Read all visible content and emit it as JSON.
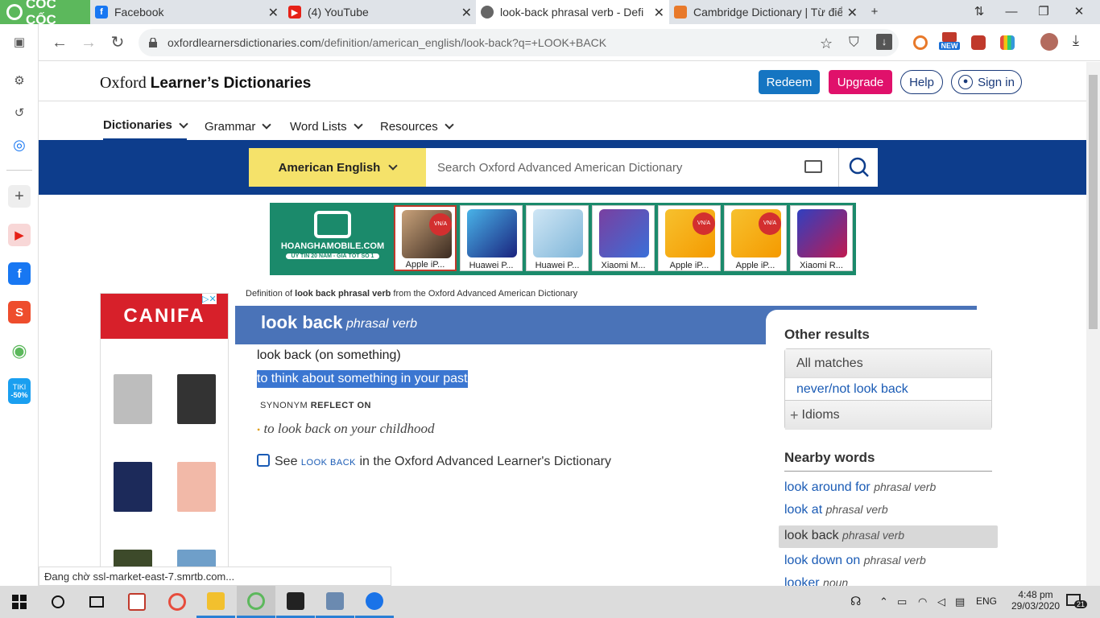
{
  "browser": {
    "brand": "CỐC CỐC",
    "tabs": [
      {
        "title": "Facebook",
        "icon": "facebook-icon",
        "color": "#1877f2"
      },
      {
        "title": "(4) YouTube",
        "icon": "youtube-icon",
        "color": "#e62117"
      },
      {
        "title": "look-back phrasal verb - Defi",
        "icon": "globe-icon",
        "color": "#444444"
      },
      {
        "title": "Cambridge Dictionary | Từ điể",
        "icon": "cambridge-icon",
        "color": "#e8792a"
      }
    ],
    "url_host": "oxfordlearnersdictionaries.com",
    "url_path": "/definition/american_english/look-back?q=+LOOK+BACK",
    "ext_new_badge": "NEW"
  },
  "sidebar": {
    "tiki_label": "TIKI",
    "tiki_discount": "-50%"
  },
  "site": {
    "logo_oxford": "Oxford",
    "logo_rest": "Learner’s Dictionaries",
    "redeem": "Redeem",
    "upgrade": "Upgrade",
    "help": "Help",
    "signin": "Sign in",
    "nav": [
      "Dictionaries",
      "Grammar",
      "Word Lists",
      "Resources"
    ],
    "dict_select": "American English",
    "search_placeholder": "Search Oxford Advanced American Dictionary",
    "accent": "#0d3d8c",
    "redeem_color": "#1575c2",
    "upgrade_color": "#e0116b"
  },
  "ad": {
    "brand": "HOANGHAMOBILE.COM",
    "tagline": "UY TÍN 20 NĂM - GIÁ TỐT SỐ 1",
    "badge": "VN/A",
    "phones": [
      "Apple iP...",
      "Huawei P...",
      "Huawei P...",
      "Xiaomi M...",
      "Apple iP...",
      "Apple iP...",
      "Xiaomi R..."
    ]
  },
  "side_ad": {
    "brand": "CANIFA"
  },
  "entry": {
    "breadcrumb_pre": "Definition of ",
    "breadcrumb_bold": "look back phrasal verb",
    "breadcrumb_post": " from the Oxford Advanced American Dictionary",
    "headword": "look back",
    "pos": "phrasal verb",
    "sense_head": "look back (on something)",
    "definition": "to think about something in your past",
    "synonym_label": "SYNONYM",
    "synonym": "REFLECT ON",
    "example": "to look back on your childhood",
    "see_pre": "See ",
    "see_link": "LOOK BACK",
    "see_post": " in the Oxford Advanced Learner's Dictionary"
  },
  "other_results": {
    "title": "Other results",
    "all_matches": "All matches",
    "match_link": "never/not look back",
    "idioms": "Idioms"
  },
  "nearby": {
    "title": "Nearby words",
    "items": [
      {
        "word": "look around for",
        "pos": "phrasal verb"
      },
      {
        "word": "look at",
        "pos": "phrasal verb"
      },
      {
        "word": "look back",
        "pos": "phrasal verb"
      },
      {
        "word": "look down on",
        "pos": "phrasal verb"
      },
      {
        "word": "looker",
        "pos": "noun"
      }
    ]
  },
  "status_text": "Đang chờ ssl-market-east-7.smrtb.com...",
  "taskbar": {
    "lang": "ENG",
    "time": "4:48 pm",
    "date": "29/03/2020",
    "notif_count": "21"
  }
}
